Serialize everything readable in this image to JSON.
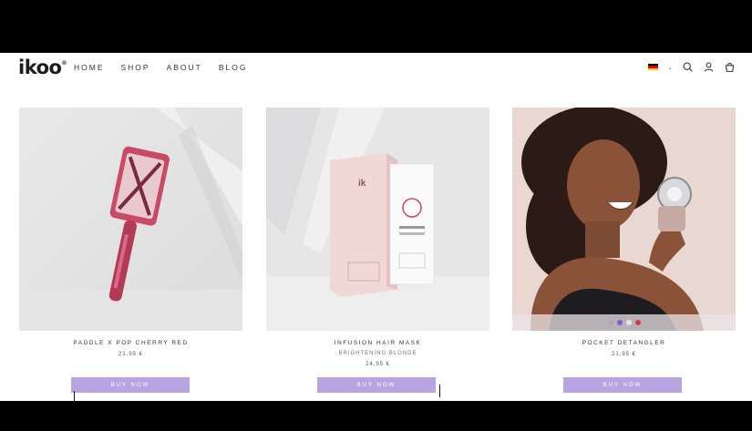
{
  "brand": {
    "logo": "ikoo",
    "mark": "®"
  },
  "nav": {
    "items": [
      "HOME",
      "SHOP",
      "ABOUT",
      "BLOG"
    ]
  },
  "header_icons": [
    "de-flag-icon",
    "chevron-down-icon",
    "search-icon",
    "user-icon",
    "bag-icon"
  ],
  "products": [
    {
      "title": "PADDLE X POP CHERRY RED",
      "price": "21,95 €",
      "button": "BUY NOW"
    },
    {
      "title": "INFUSION HAIR MASK",
      "subtitle": "BRIGHTENING BLONDE",
      "price": "24,95 €",
      "button": "BUY NOW"
    },
    {
      "title": "POCKET DETANGLER",
      "price": "21,95 €",
      "button": "BUY NOW",
      "swatches": [
        "#b0aab2",
        "#7c5bd6",
        "#e6e2e4",
        "#d8344a"
      ]
    }
  ],
  "colors": {
    "button": "#b9a3e3",
    "accent_pink": "#c84a66",
    "box_pink": "#f1d7d6"
  }
}
